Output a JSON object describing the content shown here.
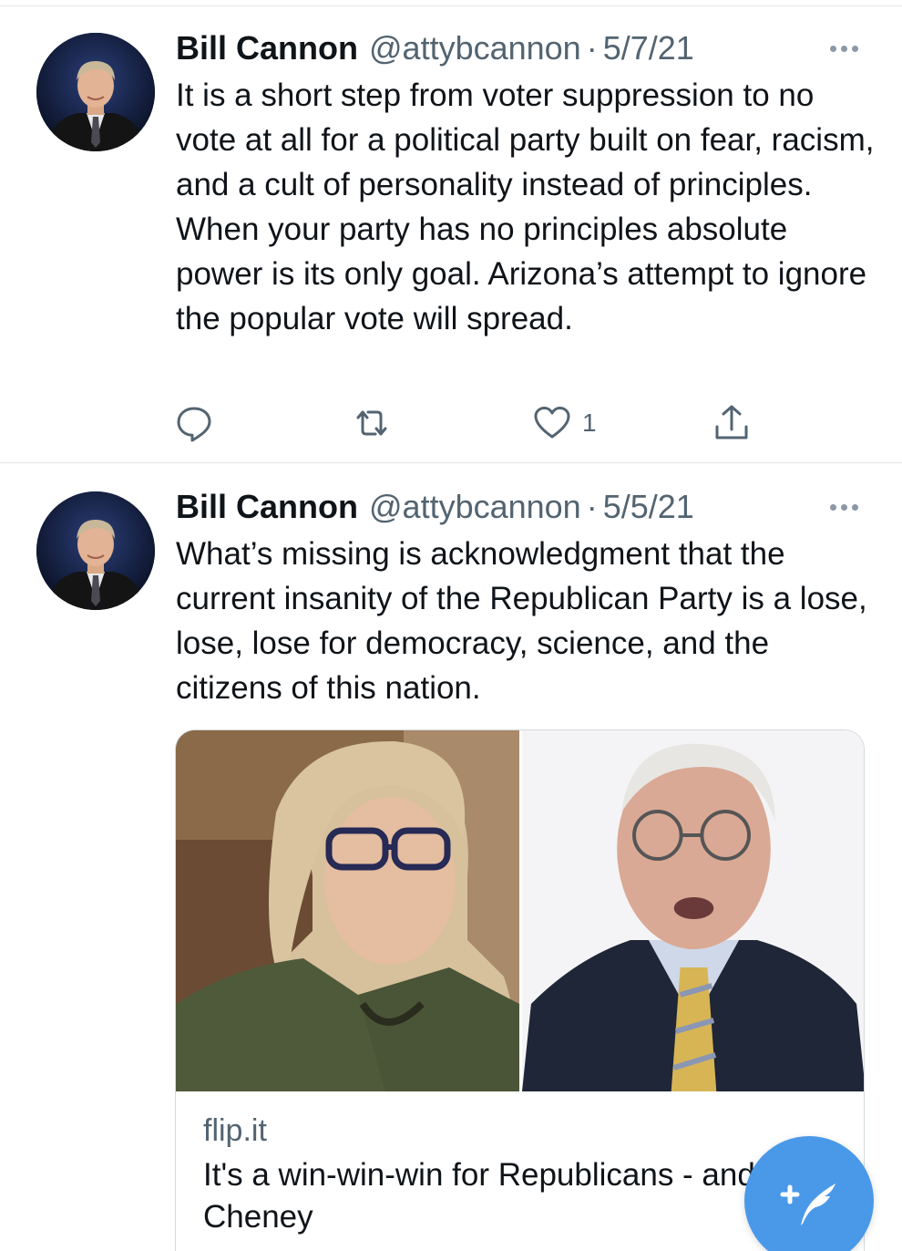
{
  "tweets": [
    {
      "author": "Bill Cannon",
      "handle": "@attybcannon",
      "separator": "·",
      "date": "5/7/21",
      "text": "It is a short step from voter suppression to no vote at all for a political party built on fear, racism, and a cult of personality instead of principles.  When your party has no principles absolute power is its only goal.  Arizona’s attempt to ignore the popular vote will spread.",
      "actions": {
        "reply_icon": "reply-icon",
        "retweet_icon": "retweet-icon",
        "like_icon": "heart-icon",
        "like_count": "1",
        "share_icon": "share-icon"
      }
    },
    {
      "author": "Bill Cannon",
      "handle": "@attybcannon",
      "separator": "·",
      "date": "5/5/21",
      "text": "What’s missing is acknowledgment that the current insanity of the Republican Party is a lose, lose, lose for democracy, science, and the citizens of this nation.",
      "card": {
        "domain": "flip.it",
        "title": "It's a win-win-win for Republicans - and Liz Cheney"
      }
    }
  ],
  "compose_button": {
    "icon": "compose-tweet-icon"
  },
  "colors": {
    "accent": "#4a99e9",
    "secondary_text": "#536471"
  }
}
